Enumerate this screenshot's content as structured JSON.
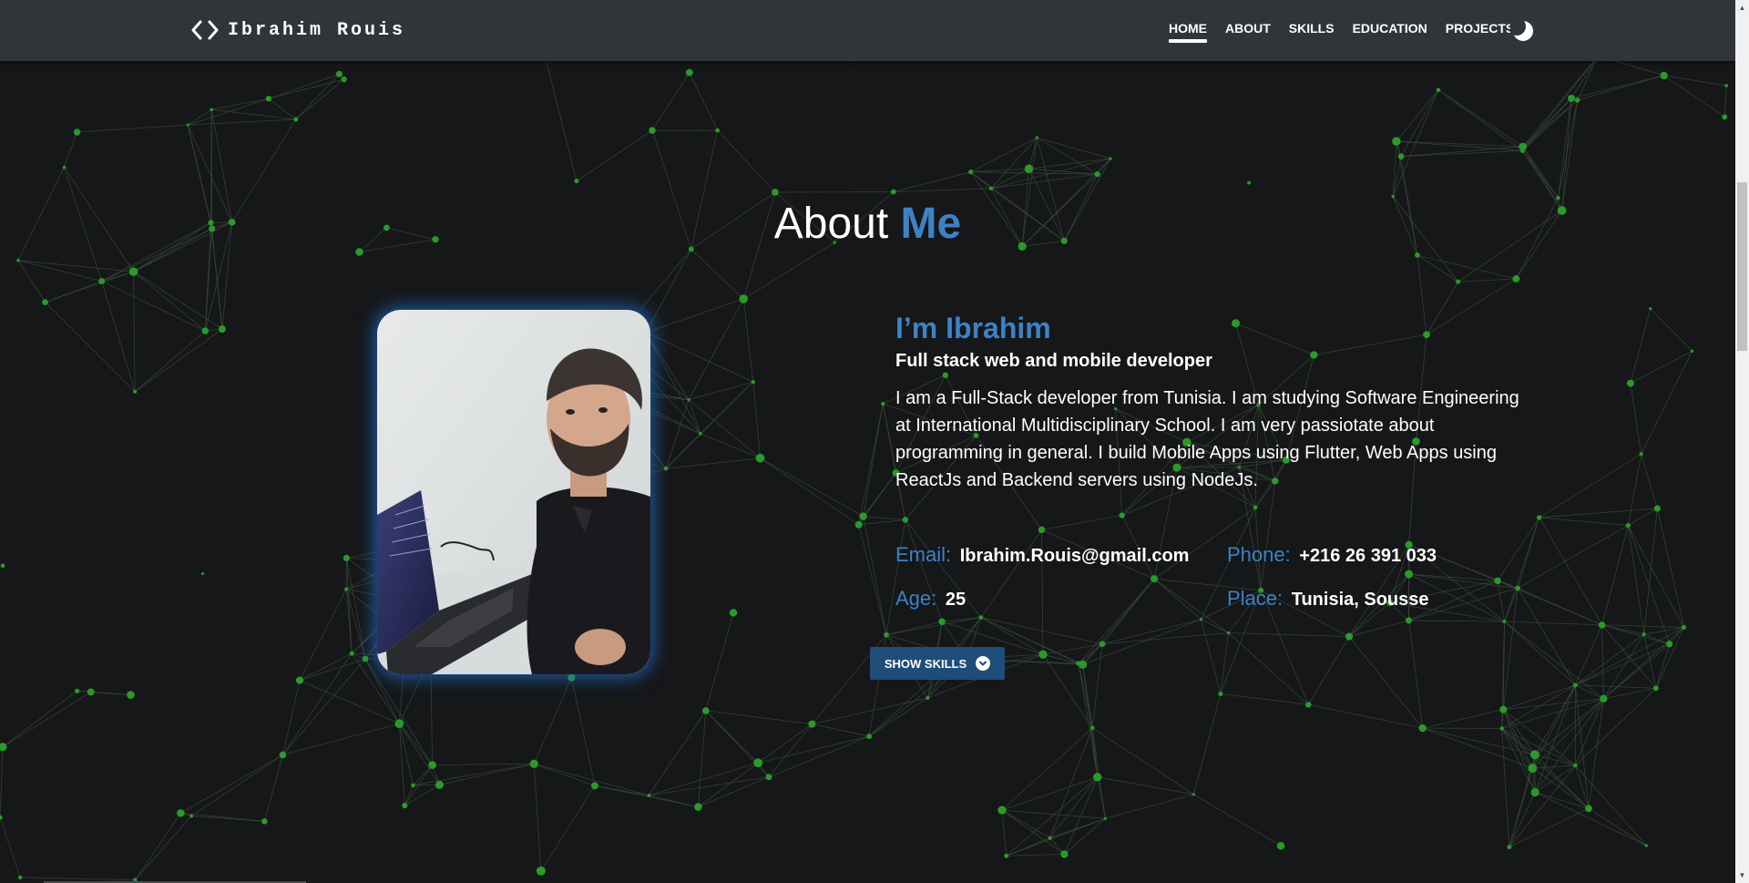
{
  "navbar": {
    "brand_icon": "code-brackets-icon",
    "brand": "Ibrahim Rouis",
    "links": [
      {
        "label": "HOME",
        "active": true
      },
      {
        "label": "ABOUT",
        "active": false
      },
      {
        "label": "SKILLS",
        "active": false
      },
      {
        "label": "EDUCATION",
        "active": false
      },
      {
        "label": "PROJECTS",
        "active": false
      }
    ],
    "theme_toggle_icon": "moon-icon"
  },
  "about": {
    "title_plain": "About",
    "title_accent": "Me",
    "greeting": "I’m Ibrahim",
    "role": "Full stack web and mobile developer",
    "bio": "I am a Full-Stack developer from Tunisia. I am studying Software Engineering at International Multidisciplinary School. I am very passiotate about programming in general. I build Mobile Apps using Flutter, Web Apps using ReactJs and Backend servers using NodeJs.",
    "details": [
      {
        "key": "Email:",
        "value": "Ibrahim.Rouis@gmail.com"
      },
      {
        "key": "Phone:",
        "value": "+216 26 391 033"
      },
      {
        "key": "Age:",
        "value": "25"
      },
      {
        "key": "Place:",
        "value": "Tunisia, Sousse"
      }
    ],
    "show_skills_label": "SHOW SKILLS",
    "show_skills_icon": "chevron-down-circle-icon"
  },
  "colors": {
    "background": "#161719",
    "navbar": "#2f3539",
    "accent": "#3c82c4",
    "button": "#1f4d7a",
    "network_node": "#2a9a2a",
    "network_line": "#3a4a3a"
  }
}
